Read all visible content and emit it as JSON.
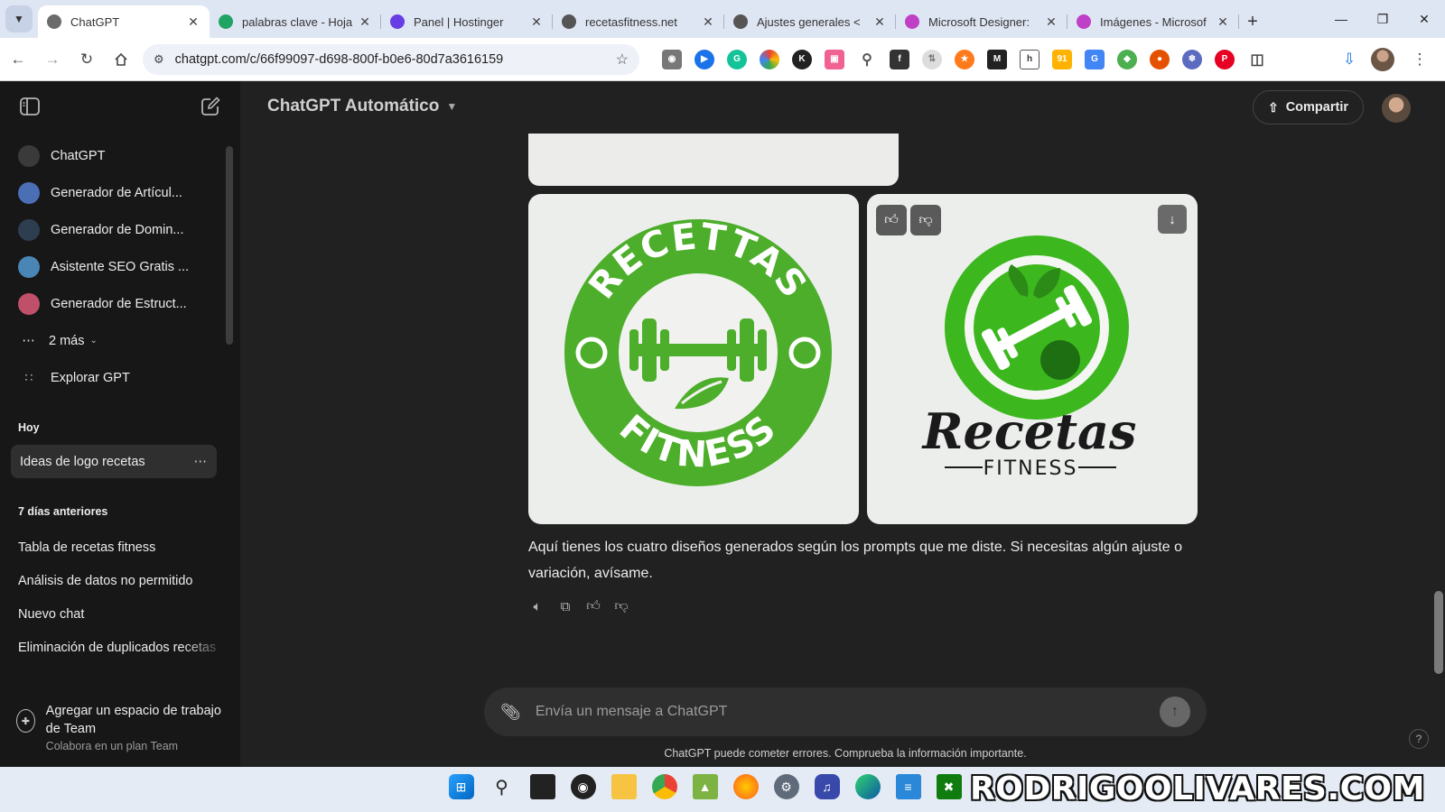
{
  "browser": {
    "tabs": [
      {
        "title": "ChatGPT",
        "active": true,
        "favicon_color": "#6b6b6b"
      },
      {
        "title": "palabras clave - Hoja",
        "active": false,
        "favicon_color": "#1fa463"
      },
      {
        "title": "Panel | Hostinger",
        "active": false,
        "favicon_color": "#673de6"
      },
      {
        "title": "recetasfitness.net",
        "active": false,
        "favicon_color": "#555555"
      },
      {
        "title": "Ajustes generales <",
        "active": false,
        "favicon_color": "#555555"
      },
      {
        "title": "Microsoft Designer:",
        "active": false,
        "favicon_color": "#c03fc7"
      },
      {
        "title": "Imágenes - Microsof",
        "active": false,
        "favicon_color": "#c03fc7"
      }
    ],
    "url": "chatgpt.com/c/66f99097-d698-800f-b0e6-80d7a3616159"
  },
  "sidebar": {
    "gpts": [
      {
        "label": "ChatGPT",
        "color": "#3a3a3a"
      },
      {
        "label": "Generador de Artícul...",
        "color": "#4a6fb5"
      },
      {
        "label": "Generador de Domin...",
        "color": "#2c3e50"
      },
      {
        "label": "Asistente SEO Gratis ...",
        "color": "#4a86b5"
      },
      {
        "label": "Generador de Estruct...",
        "color": "#c0506a"
      }
    ],
    "more_label": "2 más",
    "explore_label": "Explorar GPT",
    "section_today": "Hoy",
    "today_chats": [
      "Ideas de logo recetas"
    ],
    "section_prev": "7 días anteriores",
    "prev_chats": [
      "Tabla de recetas fitness",
      "Análisis de datos no permitido",
      "Nuevo chat",
      "Eliminación de duplicados recetas"
    ],
    "workspace_title": "Agregar un espacio de trabajo de Team",
    "workspace_sub": "Colabora en un plan Team"
  },
  "header": {
    "model": "ChatGPT Automático",
    "share_label": "Compartir"
  },
  "images": {
    "left_logo": {
      "top_text": "RECETTAS",
      "bottom_text": "FITNESS",
      "color": "#4cae2a"
    },
    "right_logo": {
      "brand": "Recetas",
      "sub": "FITNESS",
      "color": "#3cb81e"
    }
  },
  "assistant_message": "Aquí tienes los cuatro diseños generados según los prompts que me diste. Si necesitas algún ajuste o variación, avísame.",
  "composer": {
    "placeholder": "Envía un mensaje a ChatGPT"
  },
  "disclaimer": "ChatGPT puede cometer errores. Comprueba la información importante.",
  "help_label": "?",
  "watermark": "RODRIGOOLIVARES.COM"
}
